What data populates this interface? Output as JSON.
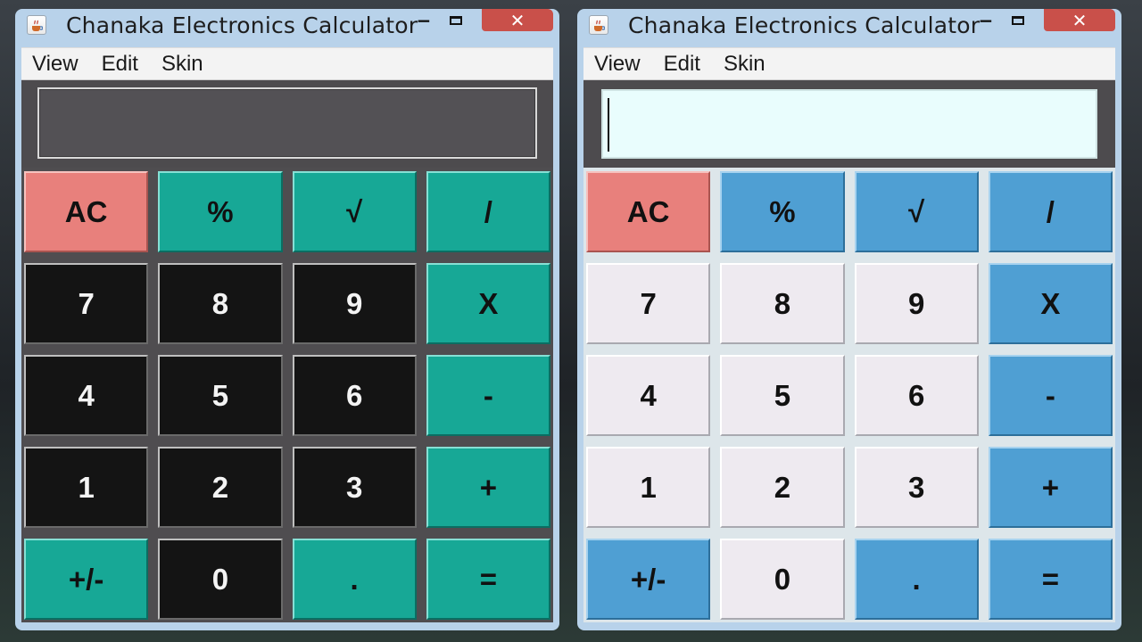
{
  "windows": [
    {
      "skin": "dark",
      "title": "Chanaka Electronics Calculator",
      "controls": {
        "minimize": "−",
        "close": "✕"
      },
      "menu": [
        "View",
        "Edit",
        "Skin"
      ],
      "display": "",
      "keys": [
        {
          "label": "AC",
          "kind": "ac"
        },
        {
          "label": "%",
          "kind": "op"
        },
        {
          "label": "√",
          "kind": "op"
        },
        {
          "label": "/",
          "kind": "op"
        },
        {
          "label": "7",
          "kind": "num"
        },
        {
          "label": "8",
          "kind": "num"
        },
        {
          "label": "9",
          "kind": "num"
        },
        {
          "label": "X",
          "kind": "op"
        },
        {
          "label": "4",
          "kind": "num"
        },
        {
          "label": "5",
          "kind": "num"
        },
        {
          "label": "6",
          "kind": "num"
        },
        {
          "label": "-",
          "kind": "op"
        },
        {
          "label": "1",
          "kind": "num"
        },
        {
          "label": "2",
          "kind": "num"
        },
        {
          "label": "3",
          "kind": "num"
        },
        {
          "label": "+",
          "kind": "op"
        },
        {
          "label": "+/-",
          "kind": "op"
        },
        {
          "label": "0",
          "kind": "num"
        },
        {
          "label": ".",
          "kind": "op"
        },
        {
          "label": "=",
          "kind": "op"
        }
      ]
    },
    {
      "skin": "light",
      "title": "Chanaka Electronics Calculator",
      "controls": {
        "minimize": "−",
        "close": "✕"
      },
      "menu": [
        "View",
        "Edit",
        "Skin"
      ],
      "display": "",
      "keys": [
        {
          "label": "AC",
          "kind": "ac"
        },
        {
          "label": "%",
          "kind": "op"
        },
        {
          "label": "√",
          "kind": "op"
        },
        {
          "label": "/",
          "kind": "op"
        },
        {
          "label": "7",
          "kind": "num"
        },
        {
          "label": "8",
          "kind": "num"
        },
        {
          "label": "9",
          "kind": "num"
        },
        {
          "label": "X",
          "kind": "op"
        },
        {
          "label": "4",
          "kind": "num"
        },
        {
          "label": "5",
          "kind": "num"
        },
        {
          "label": "6",
          "kind": "num"
        },
        {
          "label": "-",
          "kind": "op"
        },
        {
          "label": "1",
          "kind": "num"
        },
        {
          "label": "2",
          "kind": "num"
        },
        {
          "label": "3",
          "kind": "num"
        },
        {
          "label": "+",
          "kind": "op"
        },
        {
          "label": "+/-",
          "kind": "op"
        },
        {
          "label": "0",
          "kind": "num"
        },
        {
          "label": ".",
          "kind": "op"
        },
        {
          "label": "=",
          "kind": "op"
        }
      ]
    }
  ],
  "colors": {
    "dark_operator": "#17a896",
    "dark_number": "#141414",
    "light_operator": "#4f9fd3",
    "light_number": "#eeeaf0",
    "clear": "#e8807c",
    "light_display": "#e9fdfd",
    "dark_display": "#535155",
    "close_button": "#c9504a"
  },
  "icons": {
    "app": "java-cup-icon",
    "minimize": "minimize-icon",
    "maximize": "maximize-icon",
    "close": "close-icon"
  }
}
